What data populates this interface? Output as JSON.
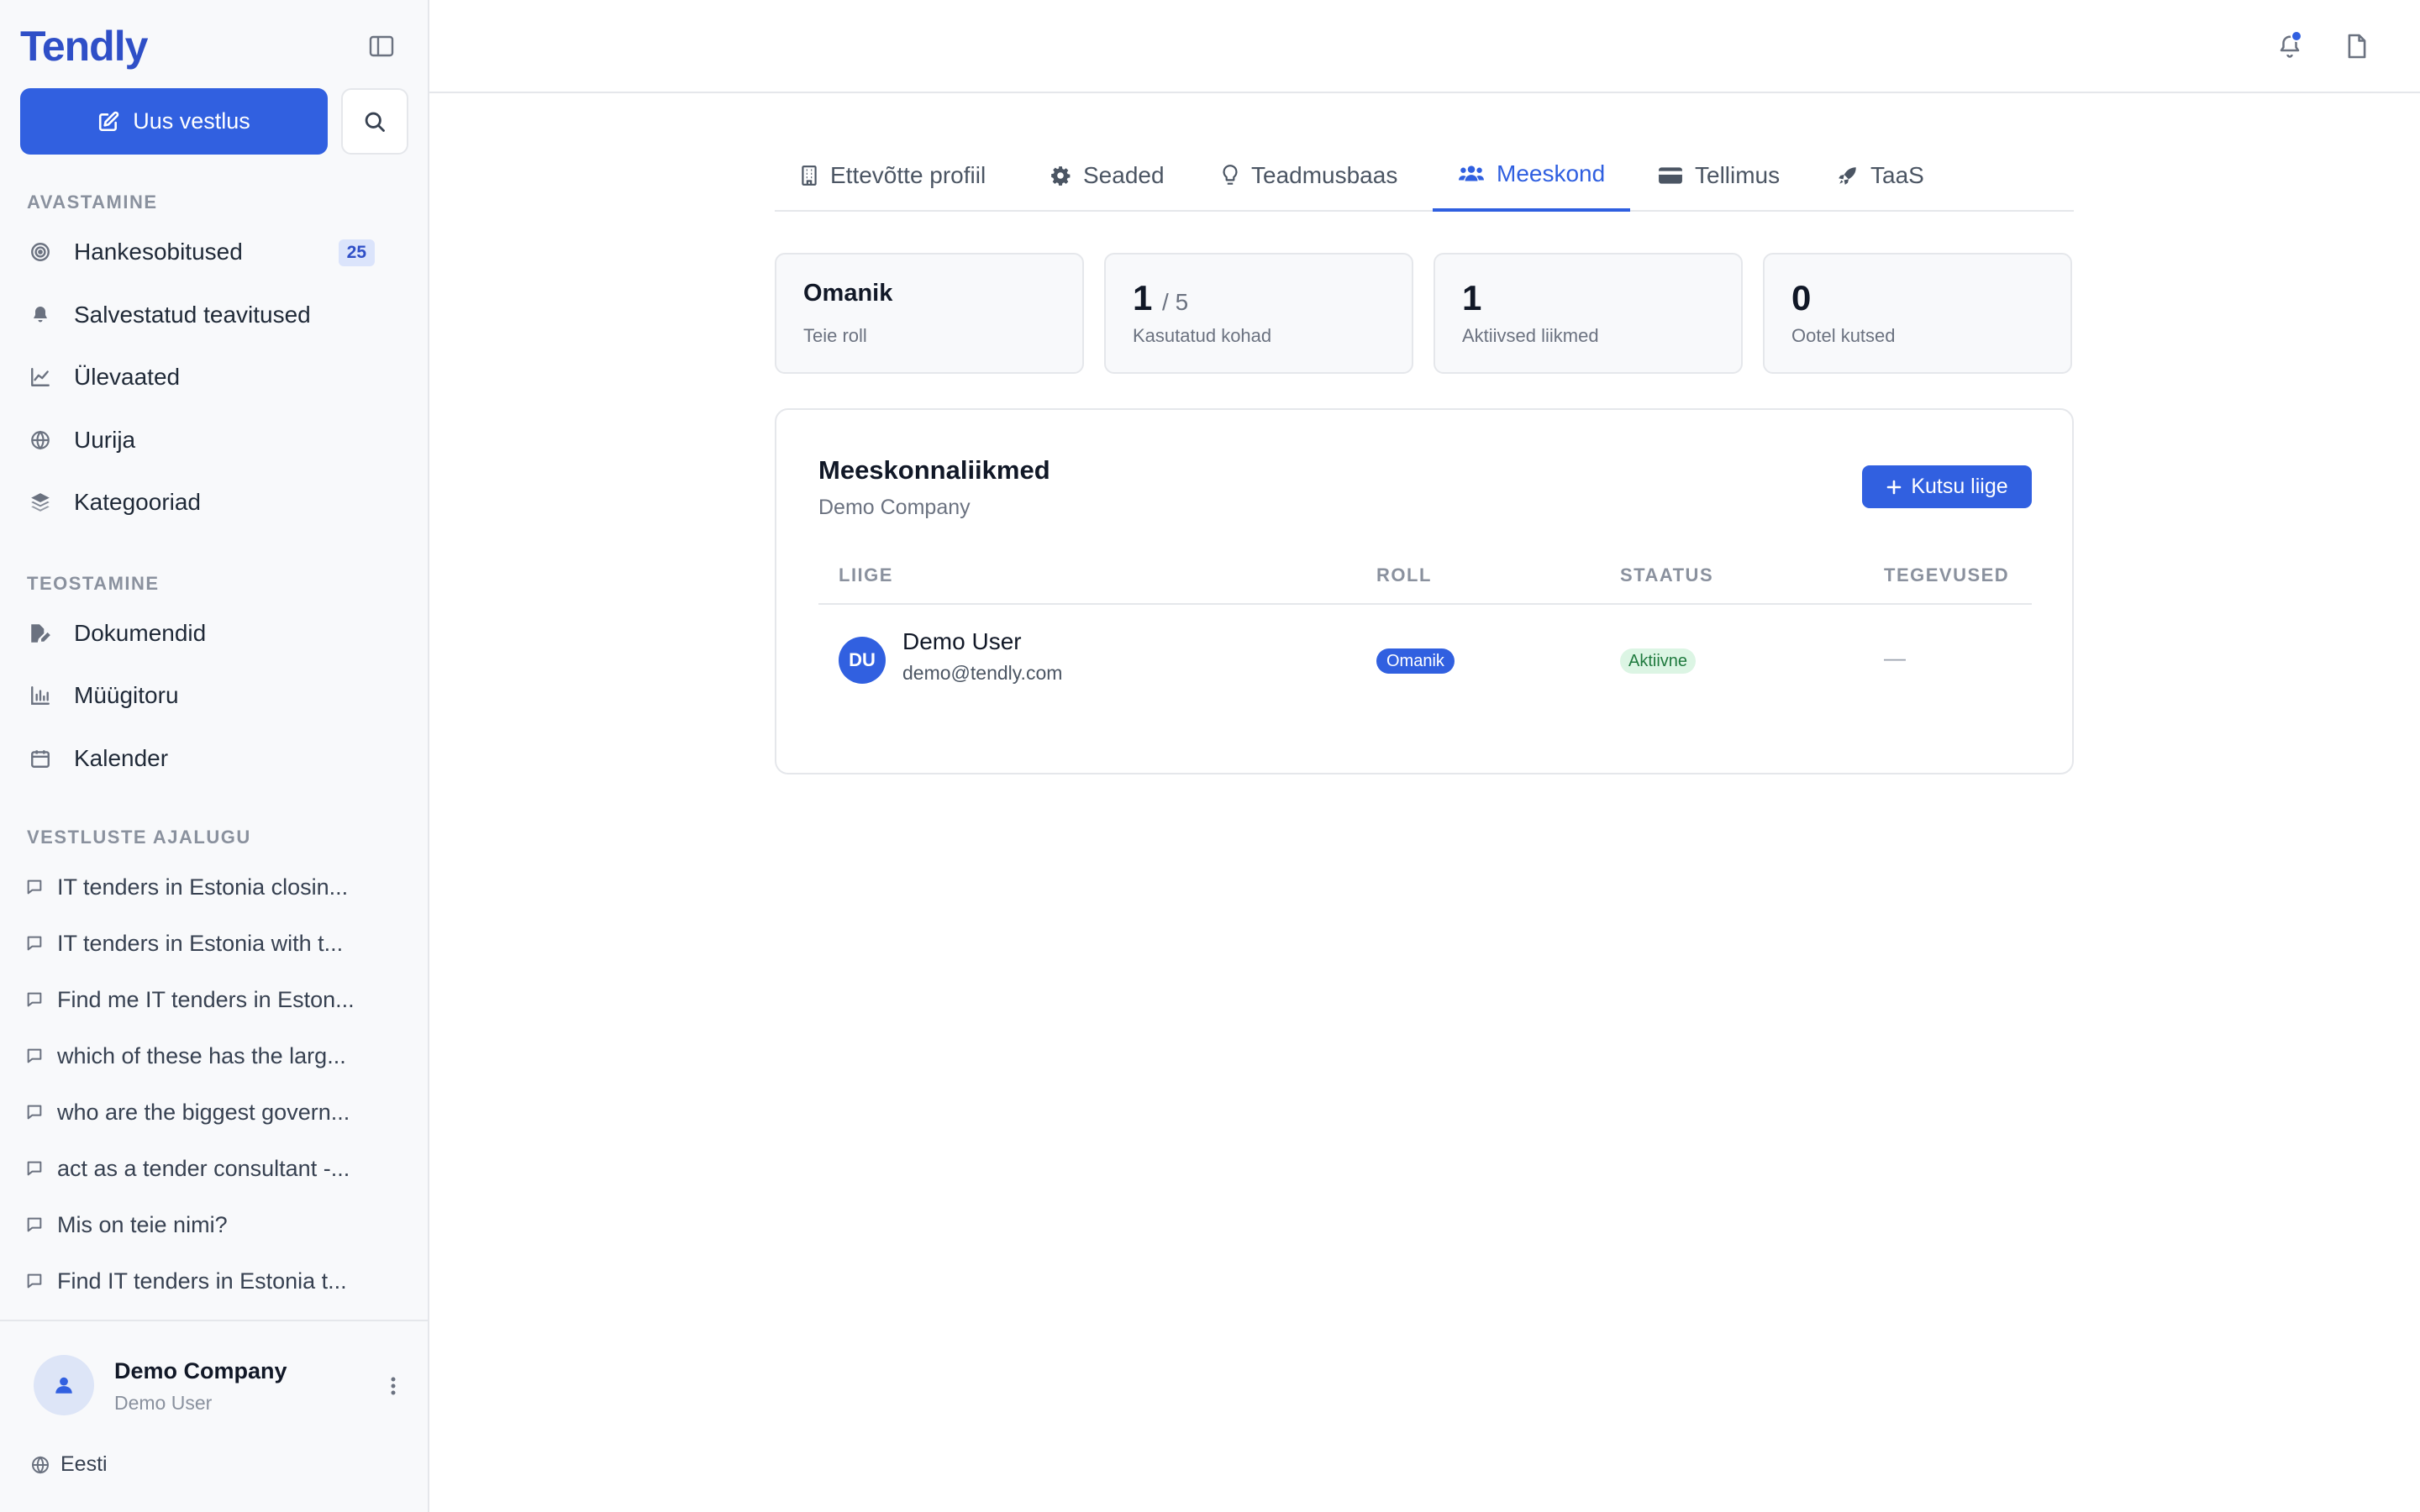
{
  "app": {
    "logo": "Tendly"
  },
  "sidebar": {
    "new_chat_label": "Uus vestlus",
    "sections": {
      "discover": "AVASTAMINE",
      "create": "TEOSTAMINE",
      "history": "VESTLUSTE AJALUGU"
    },
    "discover_items": [
      {
        "label": "Hankesobitused",
        "icon": "target-icon",
        "badge": "25"
      },
      {
        "label": "Salvestatud teavitused",
        "icon": "bell-icon"
      },
      {
        "label": "Ülevaated",
        "icon": "trend-chart-icon"
      },
      {
        "label": "Uurija",
        "icon": "globe-icon"
      },
      {
        "label": "Kategooriad",
        "icon": "layers-icon"
      }
    ],
    "create_items": [
      {
        "label": "Dokumendid",
        "icon": "file-edit-icon"
      },
      {
        "label": "Müügitoru",
        "icon": "bar-chart-icon"
      },
      {
        "label": "Kalender",
        "icon": "calendar-icon"
      }
    ],
    "history": [
      "IT tenders in Estonia closin...",
      "IT tenders in Estonia with t...",
      "Find me IT tenders in Eston...",
      "which of these has the larg...",
      "who are the biggest govern...",
      "act as a tender consultant -...",
      "Mis on teie nimi?",
      "Find IT tenders in Estonia t..."
    ],
    "user": {
      "company": "Demo Company",
      "name": "Demo User"
    },
    "language": "Eesti"
  },
  "tabs": [
    {
      "label": "Ettevõtte profiil",
      "icon": "building-icon"
    },
    {
      "label": "Seaded",
      "icon": "gear-icon"
    },
    {
      "label": "Teadmusbaas",
      "icon": "lightbulb-icon"
    },
    {
      "label": "Meeskond",
      "icon": "users-icon",
      "active": true
    },
    {
      "label": "Tellimus",
      "icon": "credit-card-icon"
    },
    {
      "label": "TaaS",
      "icon": "rocket-icon"
    }
  ],
  "stats": {
    "role": {
      "value": "Omanik",
      "label": "Teie roll"
    },
    "seats": {
      "value": "1",
      "total": "/ 5",
      "label": "Kasutatud kohad"
    },
    "active": {
      "value": "1",
      "label": "Aktiivsed liikmed"
    },
    "pending": {
      "value": "0",
      "label": "Ootel kutsed"
    }
  },
  "members": {
    "title": "Meeskonnaliikmed",
    "subtitle": "Demo Company",
    "invite_label": "Kutsu liige",
    "columns": [
      "LIIGE",
      "ROLL",
      "STAATUS",
      "TEGEVUSED"
    ],
    "rows": [
      {
        "initials": "DU",
        "name": "Demo User",
        "email": "demo@tendly.com",
        "role": "Omanik",
        "status": "Aktiivne",
        "actions": "—"
      }
    ]
  },
  "colors": {
    "accent": "#3160e0",
    "logo": "#2f4fc7",
    "status_active_bg": "#dcf5e4",
    "status_active_text": "#1f7a3e"
  }
}
